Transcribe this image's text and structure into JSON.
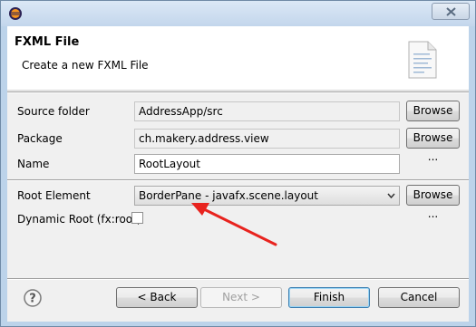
{
  "titlebar": {
    "close_icon": "close-icon",
    "app_icon": "eclipse-icon"
  },
  "header": {
    "title": "FXML File",
    "description": "Create a new FXML File",
    "icon": "document-icon"
  },
  "form": {
    "source_folder": {
      "label": "Source folder",
      "value": "AddressApp/src",
      "button": "Browse ..."
    },
    "package": {
      "label": "Package",
      "value": "ch.makery.address.view",
      "button": "Browse ..."
    },
    "name": {
      "label": "Name",
      "value": "RootLayout"
    },
    "root_element": {
      "label": "Root Element",
      "value": "BorderPane - javafx.scene.layout",
      "button": "Browse ..."
    },
    "dynamic_root": {
      "label": "Dynamic Root (fx:root)",
      "checked": false
    }
  },
  "footer": {
    "back": "< Back",
    "next": "Next >",
    "finish": "Finish",
    "cancel": "Cancel",
    "help_icon": "help-icon"
  },
  "annotation": {
    "arrow_color": "#e8231e"
  }
}
